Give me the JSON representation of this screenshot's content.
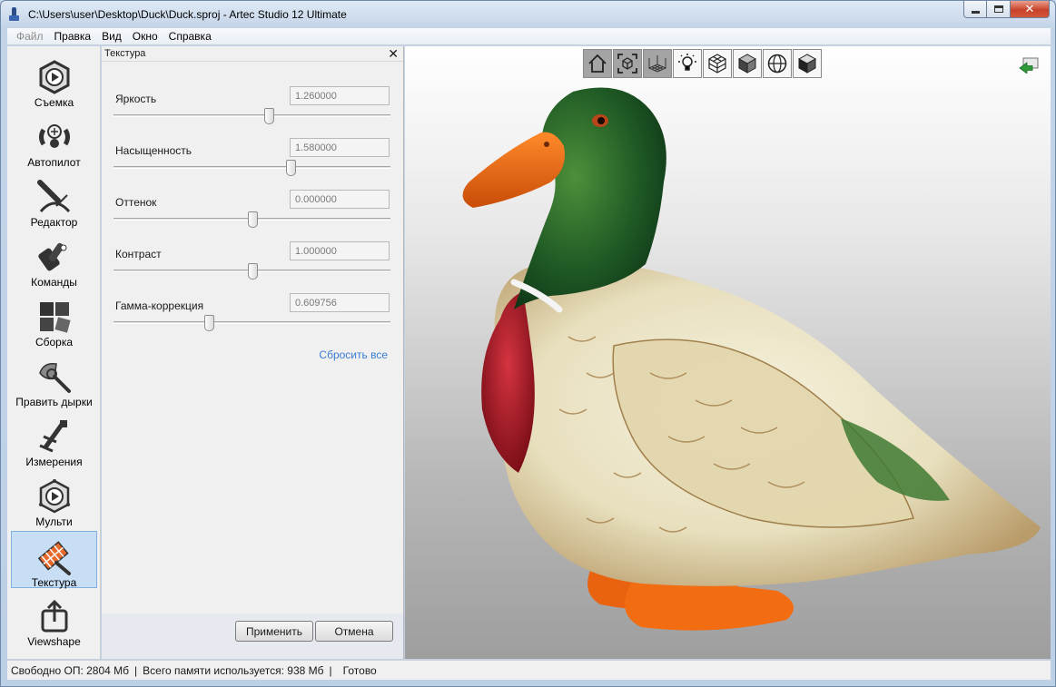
{
  "window": {
    "title": "C:\\Users\\user\\Desktop\\Duck\\Duck.sproj - Artec Studio 12 Ultimate"
  },
  "menu": [
    {
      "label": "Файл",
      "disabled": true
    },
    {
      "label": "Правка"
    },
    {
      "label": "Вид"
    },
    {
      "label": "Окно"
    },
    {
      "label": "Справка"
    }
  ],
  "tools": [
    {
      "label": "Съемка",
      "icon": "capture-icon"
    },
    {
      "label": "Автопилот",
      "icon": "autopilot-icon"
    },
    {
      "label": "Редактор",
      "icon": "editor-icon"
    },
    {
      "label": "Команды",
      "icon": "commands-icon"
    },
    {
      "label": "Сборка",
      "icon": "assembly-icon"
    },
    {
      "label": "Править дырки",
      "icon": "fix-holes-icon"
    },
    {
      "label": "Измерения",
      "icon": "measurements-icon"
    },
    {
      "label": "Мульти",
      "icon": "multi-icon"
    },
    {
      "label": "Текстура",
      "icon": "texture-icon",
      "active": true
    },
    {
      "label": "Viewshape",
      "icon": "share-icon"
    }
  ],
  "panel": {
    "title": "Текстура",
    "params": [
      {
        "label": "Яркость",
        "value": "1.260000",
        "slider": 0.56
      },
      {
        "label": "Насыщенность",
        "value": "1.580000",
        "slider": 0.64
      },
      {
        "label": "Оттенок",
        "value": "0.000000",
        "slider": 0.5
      },
      {
        "label": "Контраст",
        "value": "1.000000",
        "slider": 0.5
      },
      {
        "label": "Гамма-коррекция",
        "value": "0.609756",
        "slider": 0.345
      }
    ],
    "reset_label": "Сбросить все",
    "apply_label": "Применить",
    "cancel_label": "Отмена"
  },
  "view_toolbar": [
    {
      "icon": "home-view-icon",
      "state": "dark"
    },
    {
      "icon": "fit-view-icon",
      "state": "dark"
    },
    {
      "icon": "grid-icon",
      "state": "dark"
    },
    {
      "icon": "lightbulb-icon",
      "state": "light"
    },
    {
      "icon": "wireframe-icon",
      "state": "light"
    },
    {
      "icon": "solid-cube-icon",
      "state": "light"
    },
    {
      "icon": "sphere-icon",
      "state": "light"
    },
    {
      "icon": "textured-cube-icon",
      "state": "light"
    }
  ],
  "status": {
    "free_ram": "Свободно ОП: 2804 Мб",
    "memory_used": "Всего памяти используется: 938 Мб",
    "state": "Готово"
  },
  "colors": {
    "accent": "#3b7bd3",
    "active_tool_bg": "#c7def5",
    "duck_head_green": "#1f5a25",
    "duck_beak_orange": "#f06a10",
    "duck_breast_red": "#b61e2a",
    "duck_body_cream": "#ece6c8"
  }
}
